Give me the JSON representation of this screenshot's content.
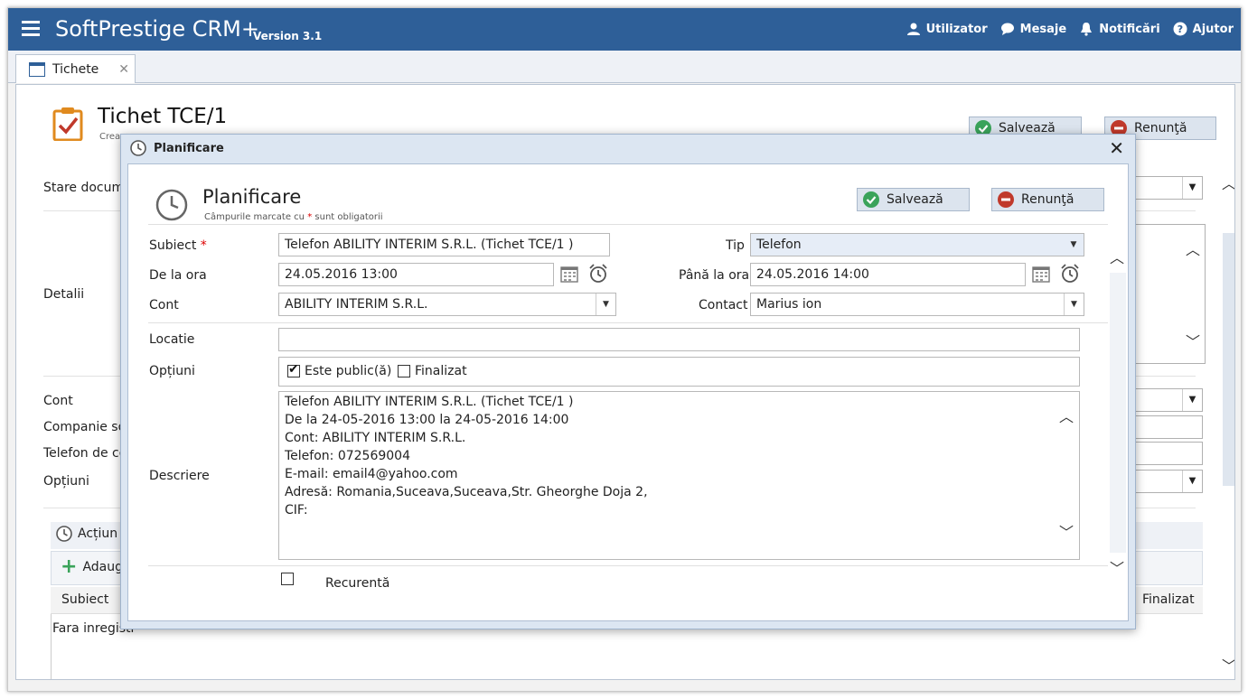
{
  "header": {
    "brand": "SoftPrestige CRM+",
    "version": "Version 3.1",
    "actions": [
      {
        "label": "Utilizator",
        "icon": "user-icon"
      },
      {
        "label": "Mesaje",
        "icon": "chat-icon"
      },
      {
        "label": "Notificări",
        "icon": "bell-icon"
      },
      {
        "label": "Ajutor",
        "icon": "help-icon"
      }
    ]
  },
  "tabs": [
    {
      "label": "Tichete",
      "close": "✕"
    }
  ],
  "page": {
    "title": "Tichet TCE/1",
    "subtitle": "Crea",
    "save_label": "Salvează",
    "cancel_label": "Renunţă",
    "fields": {
      "stare": "Stare docume",
      "detalii": "Detalii",
      "cont": "Cont",
      "companie": "Companie so",
      "telefon": "Telefon de co",
      "optiuni": "Opțiuni"
    },
    "tab_actions": "Acțiun",
    "add_label": "Adaugă",
    "table_col_subject": "Subiect",
    "table_col_finalizat": "Finalizat",
    "table_empty": "Fara inregistr"
  },
  "dialog": {
    "header_title": "Planificare",
    "close": "✕",
    "title": "Planificare",
    "subtitle_prefix": "Câmpurile marcate cu",
    "subtitle_star": "*",
    "subtitle_suffix": "sunt obligatorii",
    "save_label": "Salvează",
    "cancel_label": "Renunţă",
    "labels": {
      "subiect": "Subiect",
      "required_star": "*",
      "tip": "Tip",
      "de_la_ora": "De la ora",
      "pana_la_ora": "Până la ora",
      "cont": "Cont",
      "contact": "Contact",
      "locatie": "Locatie",
      "optiuni": "Opțiuni",
      "descriere": "Descriere",
      "recurenta": "Recurentă"
    },
    "values": {
      "subiect": "Telefon ABILITY INTERIM S.R.L. (Tichet TCE/1 )",
      "tip": "Telefon",
      "de_la_ora": "24.05.2016 13:00",
      "pana_la_ora": "24.05.2016 14:00",
      "cont": "ABILITY INTERIM S.R.L.",
      "contact": "Marius ion",
      "locatie": ""
    },
    "options": {
      "public_label": "Este public(ă)",
      "public_checked": true,
      "finalizat_label": "Finalizat",
      "finalizat_checked": false
    },
    "recurenta_checked": false,
    "descriere_lines": [
      "Telefon ABILITY INTERIM S.R.L. (Tichet TCE/1 )",
      "De la 24-05-2016 13:00 la 24-05-2016 14:00",
      "Cont: ABILITY INTERIM S.R.L.",
      "Telefon: 072569004",
      "E-mail: email4@yahoo.com",
      "Adresă: Romania,Suceava,Suceava,Str. Gheorghe Doja 2,",
      "CIF:"
    ]
  },
  "colors": {
    "header_bg": "#2e5f98",
    "button_bg": "#dce4ee",
    "save_green": "#3aa35a",
    "cancel_red": "#c0392b",
    "dialog_bg": "#dce6f2"
  }
}
